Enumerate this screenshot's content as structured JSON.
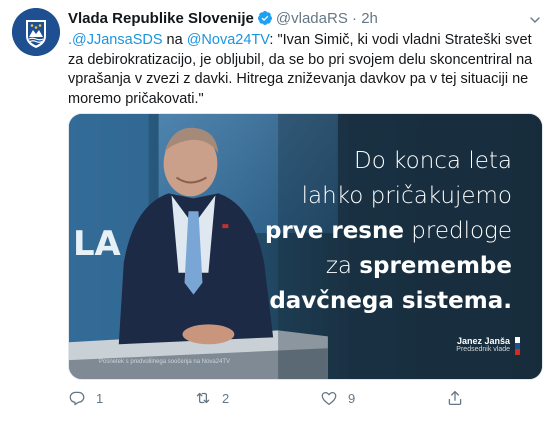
{
  "account": {
    "name": "Vlada Republike Slovenije",
    "handle": "@vladaRS",
    "separator": "·",
    "time": "2h"
  },
  "tweet": {
    "mention1": ".@JJansaSDS",
    "word_na": " na ",
    "mention2": "@Nova24TV",
    "body": ": \"Ivan Simič, ki vodi vladni Strateški svet za debirokratizacijo, je obljubil, da se bo pri svojem delu skoncentriral na vprašanja v zvezi z davki. Hitrega zniževanja davkov pa v tej situaciji ne moremo pričakovati.\""
  },
  "media": {
    "line1": "Do konca leta",
    "line2": "lahko pričakujemo",
    "line3_bold": "prve resne",
    "line3_rest": " predloge",
    "line4_pre": "za ",
    "line4_bold": "spremembe",
    "line5_bold": "davčnega sistema.",
    "signature_name": "Janez Janša",
    "signature_role": "Predsednik vlade",
    "caption": "Posnetek s predvolilnega soočenja na Nova24TV",
    "screen_letters": "LA"
  },
  "actions": {
    "reply_count": "1",
    "retweet_count": "2",
    "like_count": "9"
  },
  "colors": {
    "link": "#1b95e0",
    "secondary": "#657786",
    "verified": "#1da1f2",
    "media_bg": "#1b2f40"
  }
}
